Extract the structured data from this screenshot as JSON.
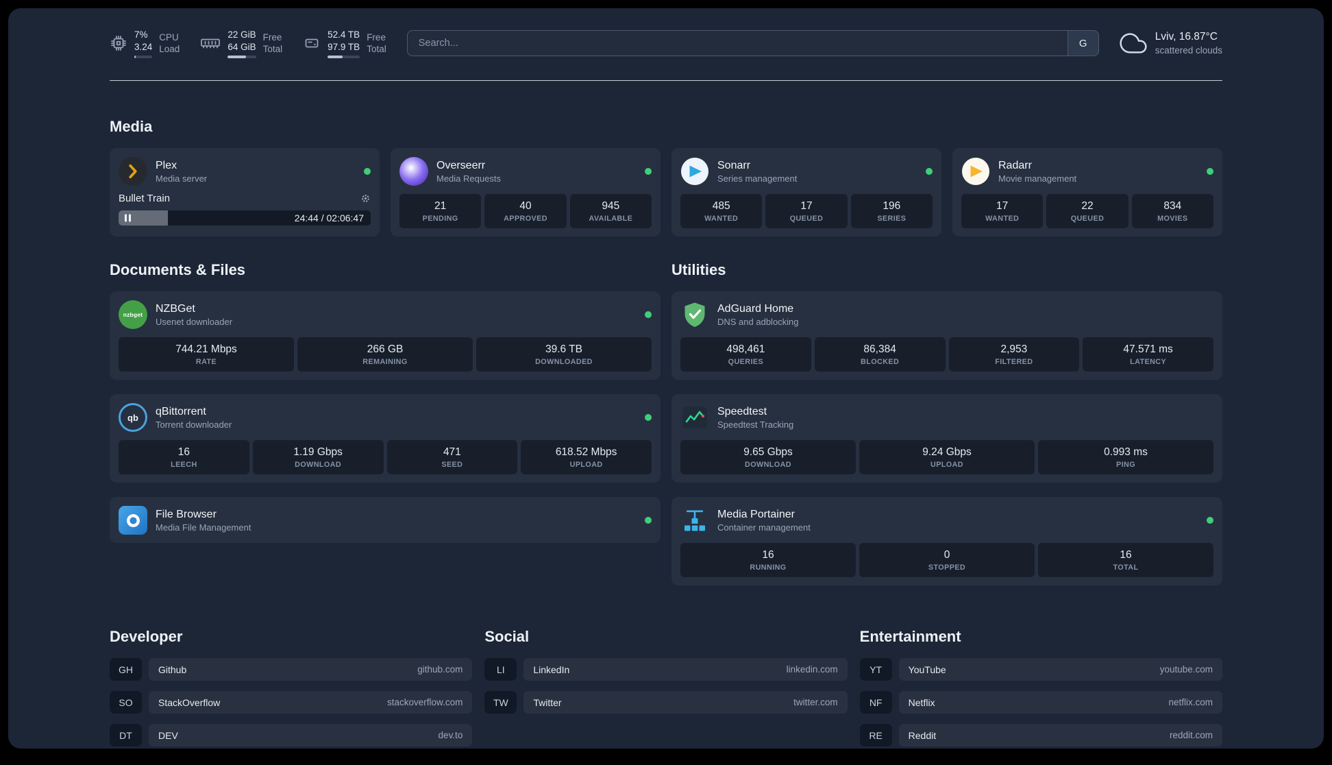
{
  "topbar": {
    "cpu": {
      "value_top": "7%",
      "value_bottom": "3.24",
      "label_top": "CPU",
      "label_bottom": "Load",
      "bar_pct": 8
    },
    "memory": {
      "value_top": "22 GiB",
      "value_bottom": "64 GiB",
      "label_top": "Free",
      "label_bottom": "Total",
      "bar_pct": 65
    },
    "disk": {
      "value_top": "52.4 TB",
      "value_bottom": "97.9 TB",
      "label_top": "Free",
      "label_bottom": "Total",
      "bar_pct": 46
    },
    "search": {
      "placeholder": "Search...",
      "provider_label": "G"
    },
    "weather": {
      "location": "Lviv, 16.87°C",
      "condition": "scattered clouds"
    }
  },
  "media": {
    "title": "Media",
    "plex": {
      "name": "Plex",
      "desc": "Media server",
      "now_playing": {
        "title": "Bullet Train",
        "time": "24:44 / 02:06:47",
        "progress_pct": 19.5
      }
    },
    "overseerr": {
      "name": "Overseerr",
      "desc": "Media Requests",
      "stats": [
        {
          "value": "21",
          "label": "PENDING"
        },
        {
          "value": "40",
          "label": "APPROVED"
        },
        {
          "value": "945",
          "label": "AVAILABLE"
        }
      ]
    },
    "sonarr": {
      "name": "Sonarr",
      "desc": "Series management",
      "stats": [
        {
          "value": "485",
          "label": "WANTED"
        },
        {
          "value": "17",
          "label": "QUEUED"
        },
        {
          "value": "196",
          "label": "SERIES"
        }
      ]
    },
    "radarr": {
      "name": "Radarr",
      "desc": "Movie management",
      "stats": [
        {
          "value": "17",
          "label": "WANTED"
        },
        {
          "value": "22",
          "label": "QUEUED"
        },
        {
          "value": "834",
          "label": "MOVIES"
        }
      ]
    }
  },
  "documents": {
    "title": "Documents & Files",
    "nzbget": {
      "name": "NZBGet",
      "desc": "Usenet downloader",
      "icon_label": "nzbget",
      "stats": [
        {
          "value": "744.21 Mbps",
          "label": "RATE"
        },
        {
          "value": "266 GB",
          "label": "REMAINING"
        },
        {
          "value": "39.6 TB",
          "label": "DOWNLOADED"
        }
      ]
    },
    "qbittorrent": {
      "name": "qBittorrent",
      "desc": "Torrent downloader",
      "icon_label": "qb",
      "stats": [
        {
          "value": "16",
          "label": "LEECH"
        },
        {
          "value": "1.19 Gbps",
          "label": "DOWNLOAD"
        },
        {
          "value": "471",
          "label": "SEED"
        },
        {
          "value": "618.52 Mbps",
          "label": "UPLOAD"
        }
      ]
    },
    "filebrowser": {
      "name": "File Browser",
      "desc": "Media File Management"
    }
  },
  "utilities": {
    "title": "Utilities",
    "adguard": {
      "name": "AdGuard Home",
      "desc": "DNS and adblocking",
      "stats": [
        {
          "value": "498,461",
          "label": "QUERIES"
        },
        {
          "value": "86,384",
          "label": "BLOCKED"
        },
        {
          "value": "2,953",
          "label": "FILTERED"
        },
        {
          "value": "47.571 ms",
          "label": "LATENCY"
        }
      ]
    },
    "speedtest": {
      "name": "Speedtest",
      "desc": "Speedtest Tracking",
      "stats": [
        {
          "value": "9.65 Gbps",
          "label": "DOWNLOAD"
        },
        {
          "value": "9.24 Gbps",
          "label": "UPLOAD"
        },
        {
          "value": "0.993 ms",
          "label": "PING"
        }
      ]
    },
    "portainer": {
      "name": "Media Portainer",
      "desc": "Container management",
      "stats": [
        {
          "value": "16",
          "label": "RUNNING"
        },
        {
          "value": "0",
          "label": "STOPPED"
        },
        {
          "value": "16",
          "label": "TOTAL"
        }
      ]
    }
  },
  "bookmarks": {
    "developer": {
      "title": "Developer",
      "items": [
        {
          "abbr": "GH",
          "name": "Github",
          "domain": "github.com"
        },
        {
          "abbr": "SO",
          "name": "StackOverflow",
          "domain": "stackoverflow.com"
        },
        {
          "abbr": "DT",
          "name": "DEV",
          "domain": "dev.to"
        }
      ]
    },
    "social": {
      "title": "Social",
      "items": [
        {
          "abbr": "LI",
          "name": "LinkedIn",
          "domain": "linkedin.com"
        },
        {
          "abbr": "TW",
          "name": "Twitter",
          "domain": "twitter.com"
        }
      ]
    },
    "entertainment": {
      "title": "Entertainment",
      "items": [
        {
          "abbr": "YT",
          "name": "YouTube",
          "domain": "youtube.com"
        },
        {
          "abbr": "NF",
          "name": "Netflix",
          "domain": "netflix.com"
        },
        {
          "abbr": "RE",
          "name": "Reddit",
          "domain": "reddit.com"
        }
      ]
    }
  },
  "colors": {
    "status_online": "#3ecf79",
    "background": "#1d2637",
    "accent_amber": "#e5a00d"
  }
}
